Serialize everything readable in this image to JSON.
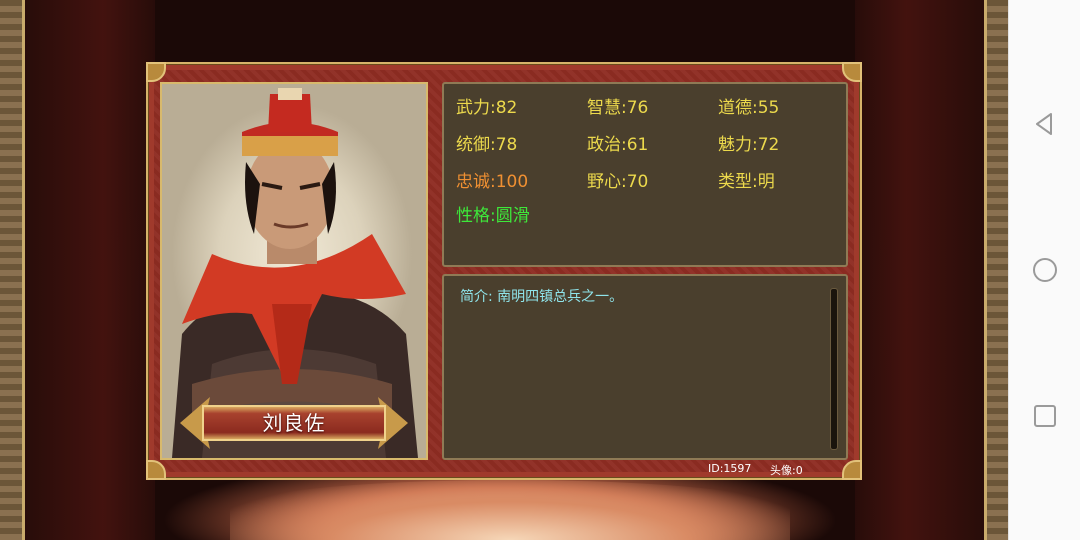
{
  "character": {
    "name": "刘良佐"
  },
  "stats": {
    "row1": [
      "武力:82",
      "智慧:76",
      "道德:55"
    ],
    "row2": [
      "统御:78",
      "政治:61",
      "魅力:72"
    ],
    "row3": [
      "忠诚:100",
      "野心:70",
      "类型:明"
    ],
    "row4": [
      "性格:圆滑"
    ]
  },
  "intro": {
    "text": "简介: 南明四镇总兵之一。"
  },
  "footer": {
    "id": "ID:1597",
    "avatar": "头像:0"
  },
  "colors": {
    "stat_default": "#ecd94c",
    "loyalty": "#f09032",
    "personality": "#3ee83a",
    "intro": "#8fe4ea",
    "panel_bg": "#4a3f2d",
    "dialog_bg": "#8e2c22"
  },
  "navbar": {
    "icons": [
      "back-icon",
      "home-icon",
      "recents-icon"
    ]
  }
}
